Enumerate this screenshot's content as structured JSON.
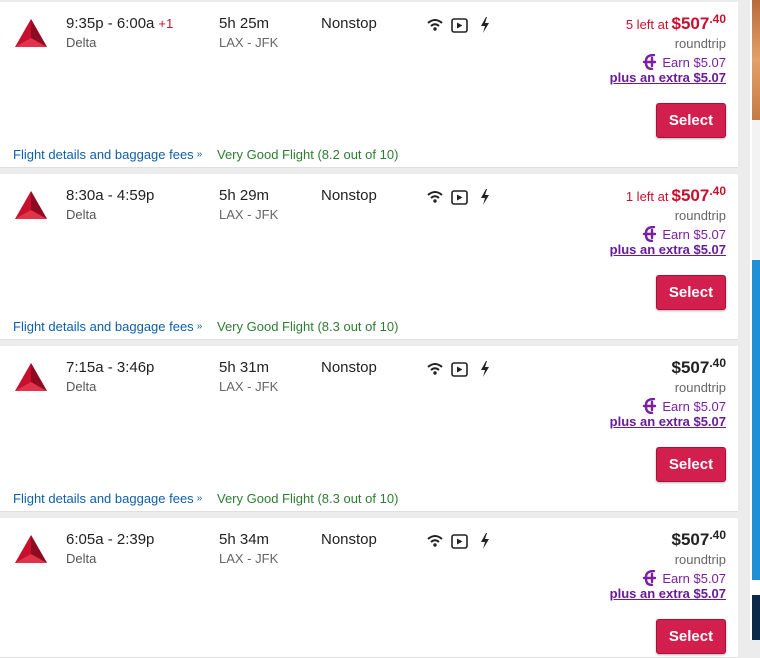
{
  "flights": [
    {
      "times": "9:35p - 6:00a",
      "day_offset": "+1",
      "airline": "Delta",
      "duration": "5h 25m",
      "route": "LAX - JFK",
      "stops": "Nonstop",
      "seats_left": "5 left at",
      "price_main": "$507",
      "price_cents": ".40",
      "price_color": "#c8102e",
      "trip_type": "roundtrip",
      "earn": "Earn $5.07",
      "extra": "plus an extra $5.07",
      "select_label": "Select",
      "details_label": "Flight details and baggage fees",
      "rating_label": "Very Good Flight",
      "rating_score": "(8.2 out of 10)"
    },
    {
      "times": "8:30a - 4:59p",
      "day_offset": "",
      "airline": "Delta",
      "duration": "5h 29m",
      "route": "LAX - JFK",
      "stops": "Nonstop",
      "seats_left": "1 left at",
      "price_main": "$507",
      "price_cents": ".40",
      "price_color": "#c8102e",
      "trip_type": "roundtrip",
      "earn": "Earn $5.07",
      "extra": "plus an extra $5.07",
      "select_label": "Select",
      "details_label": "Flight details and baggage fees",
      "rating_label": "Very Good Flight",
      "rating_score": "(8.3 out of 10)"
    },
    {
      "times": "7:15a - 3:46p",
      "day_offset": "",
      "airline": "Delta",
      "duration": "5h 31m",
      "route": "LAX - JFK",
      "stops": "Nonstop",
      "seats_left": "",
      "price_main": "$507",
      "price_cents": ".40",
      "price_color": "#222222",
      "trip_type": "roundtrip",
      "earn": "Earn $5.07",
      "extra": "plus an extra $5.07",
      "select_label": "Select",
      "details_label": "Flight details and baggage fees",
      "rating_label": "Very Good Flight",
      "rating_score": "(8.3 out of 10)"
    },
    {
      "times": "6:05a - 2:39p",
      "day_offset": "",
      "airline": "Delta",
      "duration": "5h 34m",
      "route": "LAX - JFK",
      "stops": "Nonstop",
      "seats_left": "",
      "price_main": "$507",
      "price_cents": ".40",
      "price_color": "#222222",
      "trip_type": "roundtrip",
      "earn": "Earn $5.07",
      "extra": "plus an extra $5.07",
      "select_label": "Select",
      "details_label": "",
      "rating_label": "",
      "rating_score": ""
    }
  ],
  "amenity_icons": [
    "wifi-icon",
    "video-icon",
    "power-icon"
  ],
  "colors": {
    "airline_red": "#c8102e",
    "select_button": "#d31f4e",
    "link_blue": "#0e5fa8",
    "rating_green": "#2e7d32",
    "reward_purple": "#7b1fa2"
  }
}
